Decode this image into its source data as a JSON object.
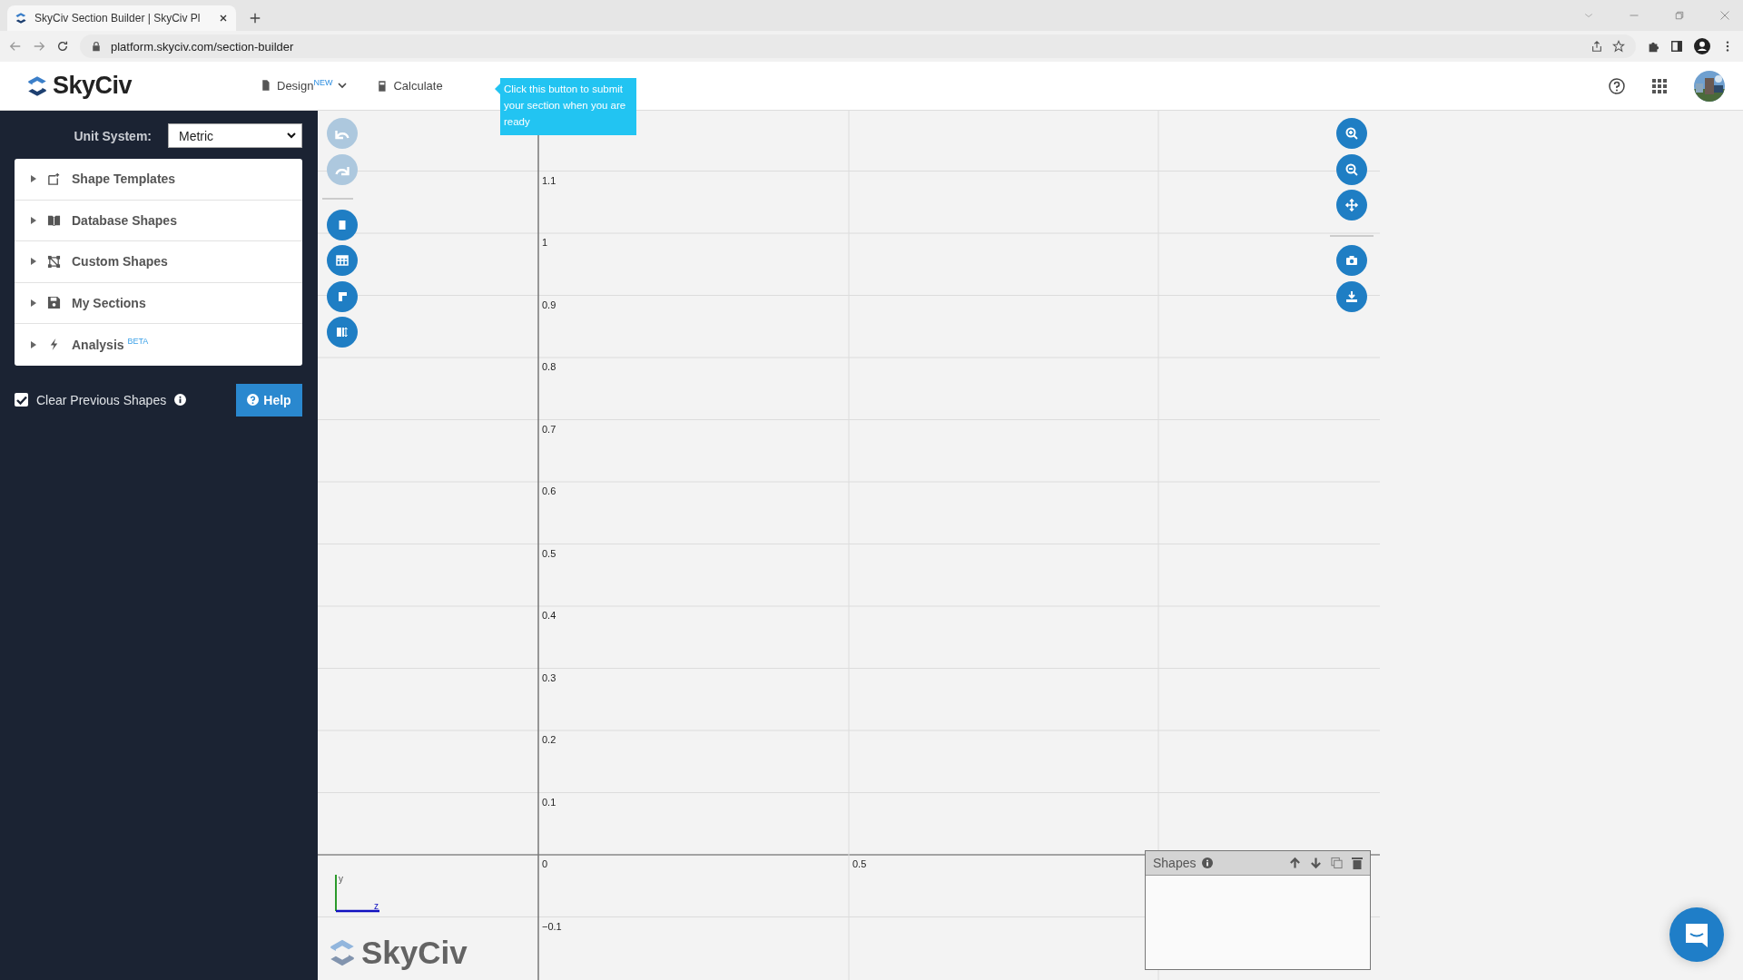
{
  "browser": {
    "tab_title": "SkyCiv Section Builder | SkyCiv Pl",
    "url": "platform.skyciv.com/section-builder"
  },
  "header": {
    "logo": "SkyCiv",
    "nav": [
      {
        "label": "Design",
        "badge": "NEW",
        "dropdown": true
      },
      {
        "label": "Calculate",
        "dropdown": false
      }
    ],
    "tooltip": "Click this button to submit your section when you are ready"
  },
  "sidebar": {
    "unit_label": "Unit System:",
    "unit_value": "Metric",
    "sections": [
      {
        "label": "Shape Templates",
        "expanded": false
      },
      {
        "label": "Database Shapes",
        "expanded": false
      },
      {
        "label": "Custom Shapes",
        "expanded": false
      },
      {
        "label": "My Sections",
        "expanded": false
      },
      {
        "label": "Analysis",
        "badge": "BETA",
        "expanded": false
      }
    ],
    "clear_previous": {
      "label": "Clear Previous Shapes",
      "checked": true
    },
    "help": "Help"
  },
  "canvas": {
    "left_tools": [
      {
        "disabled": true
      },
      {
        "disabled": true
      },
      {
        "disabled": false
      },
      {
        "disabled": false
      },
      {
        "disabled": false
      },
      {
        "disabled": false
      }
    ],
    "y_ticks": [
      "1.1",
      "1",
      "0.9",
      "0.8",
      "0.7",
      "0.6",
      "0.5",
      "0.4",
      "0.3",
      "0.2",
      "0.1",
      "0",
      "−0.1"
    ],
    "x_ticks": [
      "0.5"
    ],
    "axis_y": "y",
    "axis_z": "z",
    "shapes_panel": {
      "title": "Shapes"
    },
    "logo": "SkyCiv"
  }
}
